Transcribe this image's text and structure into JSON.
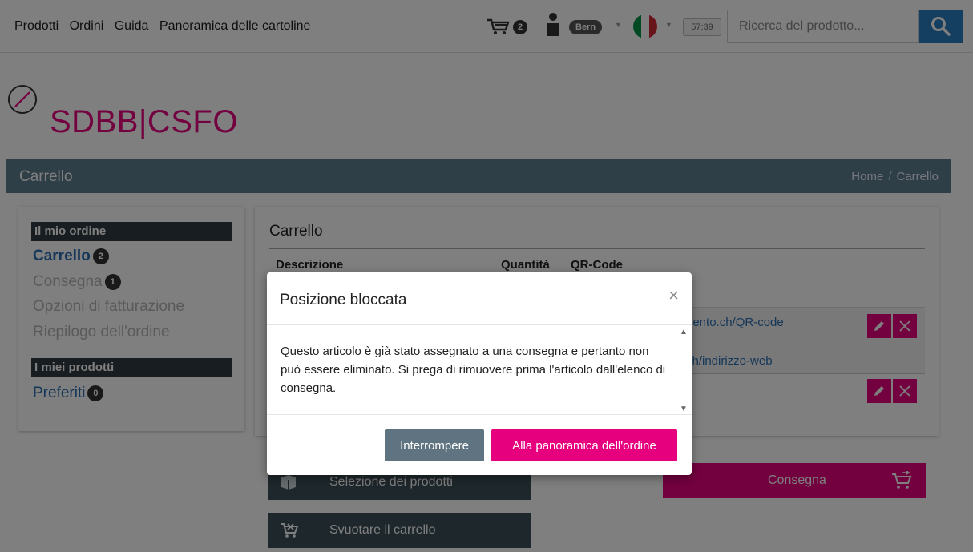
{
  "topnav": {
    "items": [
      "Prodotti",
      "Ordini",
      "Guida",
      "Panoramica delle cartoline"
    ]
  },
  "header": {
    "cart_count": "2",
    "user_location": "Bern",
    "language_flag": "italy-flag-icon",
    "session_timer": "57:39",
    "search_placeholder": "Ricerca del prodotto..."
  },
  "logo": {
    "left": "SDBB",
    "separator": "|",
    "right": "CSFO",
    "brand_color": "#e6007e"
  },
  "titlebar": {
    "title": "Carrello",
    "breadcrumb_home": "Home",
    "breadcrumb_sep": "/",
    "breadcrumb_current": "Carrello"
  },
  "sidebar": {
    "section1": "Il mio ordine",
    "items": [
      {
        "label": "Carrello",
        "badge": "2"
      },
      {
        "label": "Consegna",
        "badge": "1"
      },
      {
        "label": "Opzioni di fatturazione"
      },
      {
        "label": "Riepilogo dell'ordine"
      }
    ],
    "section2": "I miei prodotti",
    "favorites": {
      "label": "Preferiti",
      "badge": "0"
    }
  },
  "cart_panel": {
    "title": "Carrello",
    "columns": [
      "Descrizione",
      "Quantità",
      "QR-Code"
    ],
    "row1_links": [
      "nento.ch/QR-code",
      "ch/indirizzo-web"
    ]
  },
  "actions": {
    "select_products": "Selezione dei prodotti",
    "empty_cart": "Svuotare il carrello",
    "delivery": "Consegna"
  },
  "modal": {
    "title": "Posizione bloccata",
    "close": "×",
    "message": "Questo articolo è già stato assegnato a una consegna e pertanto non può essere eliminato. Si prega di rimuovere prima l'articolo dall'elenco di consegna.",
    "cancel_label": "Interrompere",
    "confirm_label": "Alla panoramica dell'ordine"
  },
  "colors": {
    "accent_pink": "#e6007e",
    "link_blue": "#2b6fb3",
    "titlebar": "#5f7f8f",
    "dark_button": "#3d4f57"
  }
}
